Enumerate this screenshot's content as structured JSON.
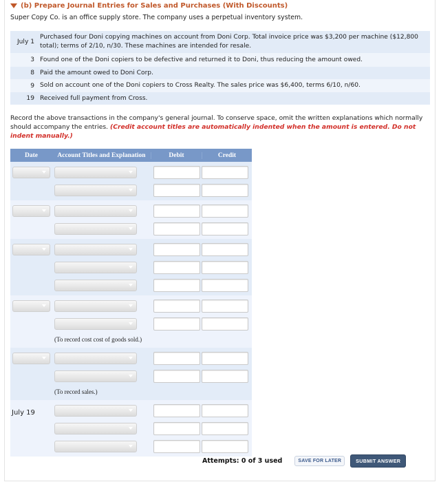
{
  "section": {
    "title": "(b)  Prepare Journal Entries for Sales and Purchases (With Discounts)",
    "intro": "Super Copy Co. is an office supply store. The company uses a perpetual inventory system."
  },
  "transactions": [
    {
      "date": "July 1",
      "description": "Purchased four Doni copying machines on account from Doni Corp. Total invoice price was $3,200 per machine ($12,800 total); terms of 2/10, n/30. These machines are intended for resale."
    },
    {
      "date": "3",
      "description": "Found one of the Doni copiers to be defective and returned it to Doni, thus reducing the amount owed."
    },
    {
      "date": "8",
      "description": "Paid the amount owed to Doni Corp."
    },
    {
      "date": "9",
      "description": "Sold on account one of the Doni copiers to Cross Realty. The sales price was $6,400, terms 6/10, n/60."
    },
    {
      "date": "19",
      "description": "Received full payment from Cross."
    }
  ],
  "instructions": {
    "text": "Record the above transactions in the company's general journal. To conserve space, omit the written explanations which normally should accompany the entries. ",
    "emphasis": "(Credit account titles are automatically indented when the amount is entered. Do not indent manually.)"
  },
  "journal": {
    "headers": {
      "date": "Date",
      "account": "Account Titles and Explanation",
      "debit": "Debit",
      "credit": "Credit"
    },
    "notes": {
      "cogs": "(To record cost cost of goods sold.)",
      "sales": "(To record sales.)"
    },
    "fixed_date": "July 19"
  },
  "footer": {
    "attempts": "Attempts: 0 of 3 used",
    "save_label": "SAVE FOR LATER",
    "submit_label": "SUBMIT ANSWER"
  },
  "colors": {
    "title": "#c0582a",
    "emphasis": "#d2302a",
    "table_header": "#7898c8",
    "submit_bg": "#3f5878"
  }
}
